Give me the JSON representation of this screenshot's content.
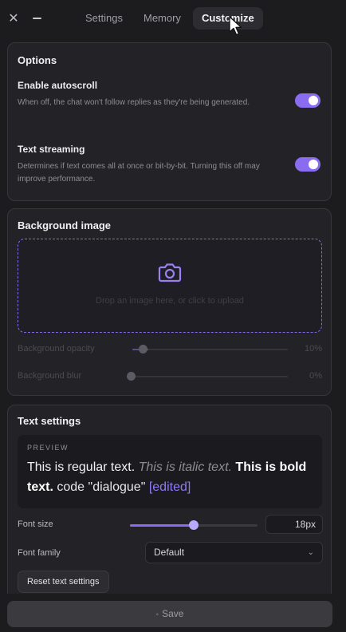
{
  "window": {
    "close_icon": "close-icon",
    "minimize_icon": "minimize-icon"
  },
  "tabs": [
    {
      "label": "Settings"
    },
    {
      "label": "Memory"
    },
    {
      "label": "Customize"
    }
  ],
  "active_tab": "Customize",
  "options": {
    "title": "Options",
    "autoscroll": {
      "title": "Enable autoscroll",
      "desc": "When off, the chat won't follow replies as they're being generated.",
      "enabled": true
    },
    "streaming": {
      "title": "Text streaming",
      "desc": "Determines if text comes all at once or bit-by-bit. Turning this off may improve performance.",
      "enabled": true
    }
  },
  "background": {
    "title": "Background image",
    "dropzone_text": "Drop an image here, or click to upload",
    "opacity": {
      "label": "Background opacity",
      "value": "10%",
      "fraction": 0.1
    },
    "blur": {
      "label": "Background blur",
      "value": "0%",
      "fraction": 0.0
    }
  },
  "text_settings": {
    "title": "Text settings",
    "preview_label": "PREVIEW",
    "preview": {
      "regular": "This is regular text.",
      "italic": "This is italic text.",
      "bold": "This is bold text.",
      "code": "code",
      "dialogue": "\"dialogue\"",
      "edited": "[edited]"
    },
    "font_size": {
      "label": "Font size",
      "value": "18px",
      "fraction": 0.5
    },
    "font_family": {
      "label": "Font family",
      "value": "Default"
    },
    "reset_label": "Reset text settings"
  },
  "save_label": "Save",
  "colors": {
    "accent": "#8a6cf0",
    "edited": "#8f79f5"
  }
}
